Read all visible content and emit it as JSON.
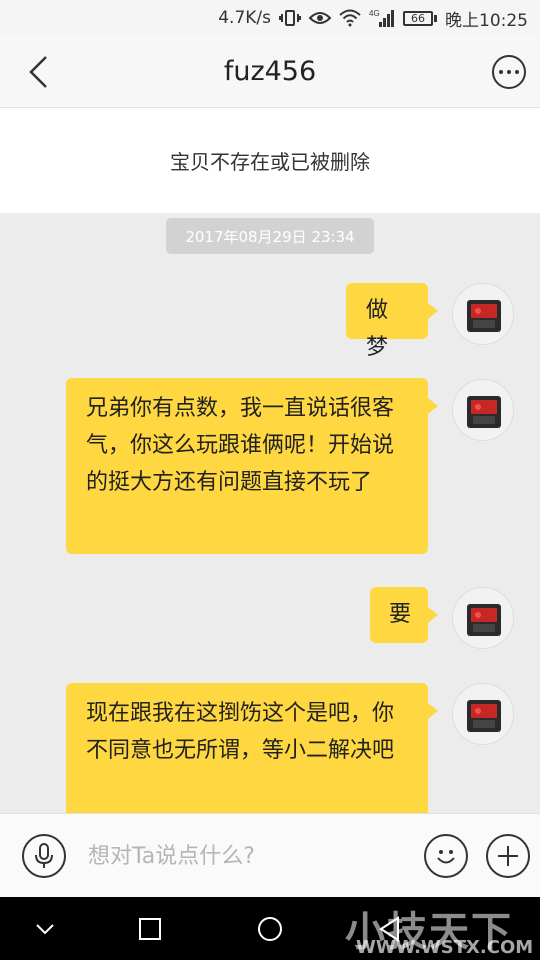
{
  "status_bar": {
    "speed": "4.7K/s",
    "network": "4G",
    "battery": "66",
    "time": "晚上10:25",
    "icons": [
      "vibrate-icon",
      "eye-icon",
      "wifi-icon",
      "signal-icon",
      "battery-icon"
    ]
  },
  "header": {
    "title": "fuz456",
    "back_icon": "chevron-left-icon",
    "more_icon": "more-icon"
  },
  "item_notice": "宝贝不存在或已被删除",
  "chat": {
    "timestamp": "2017年08月29日 23:34",
    "messages": [
      {
        "text": "做梦"
      },
      {
        "text": "兄弟你有点数，我一直说话很客气，你这么玩跟谁俩呢！开始说的挺大方还有问题直接不玩了"
      },
      {
        "text": "要"
      },
      {
        "text": "现在跟我在这捯饬这个是吧，你不同意也无所谓，等小二解决吧"
      }
    ],
    "bubble_color": "#ffd740"
  },
  "input": {
    "placeholder": "想对Ta说点什么?",
    "voice_icon": "microphone-icon",
    "emoji_icon": "smiley-icon",
    "add_icon": "plus-icon"
  },
  "nav": {
    "icons": [
      "nav-back-icon",
      "recents-icon",
      "home-icon",
      "nav-triangle-icon"
    ],
    "watermark": "小技天下",
    "watermark_url": "WWW.WSTX.COM"
  }
}
